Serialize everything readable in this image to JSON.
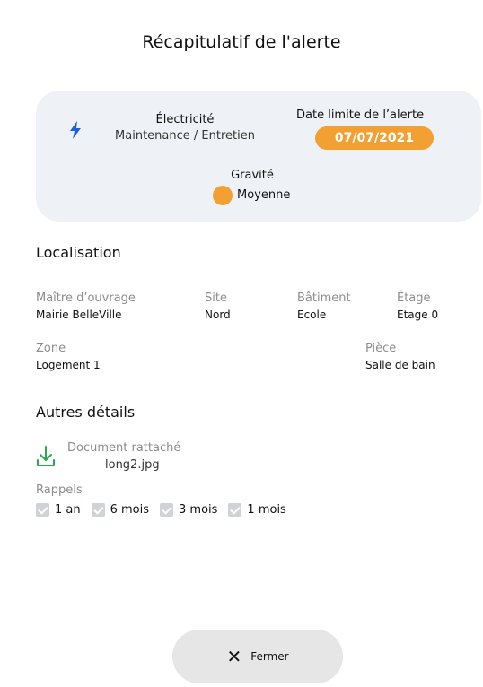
{
  "title": "Récapitulatif de l'alerte",
  "summary": {
    "category": "Électricité",
    "subcategory": "Maintenance / Entretien",
    "deadline_label": "Date limite de l’alerte",
    "deadline": "07/07/2021",
    "severity_label": "Gravité",
    "severity": "Moyenne",
    "severity_color": "#f3a033",
    "category_icon": "lightning-bolt-icon"
  },
  "location": {
    "section_title": "Localisation",
    "owner_label": "Maître d’ouvrage",
    "owner": "Mairie BelleVille",
    "site_label": "Site",
    "site": "Nord",
    "building_label": "Bâtiment",
    "building": "Ecole",
    "floor_label": "Étage",
    "floor": "Etage 0",
    "zone_label": "Zone",
    "zone": "Logement 1",
    "room_label": "Pièce",
    "room": "Salle de bain"
  },
  "details": {
    "section_title": "Autres détails",
    "document_label": "Document rattaché",
    "document_file": "long2.jpg",
    "reminders_label": "Rappels",
    "reminders": [
      "1 an",
      "6 mois",
      "3 mois",
      "1 mois"
    ]
  },
  "close_button": {
    "label": "Fermer",
    "icon": "close-icon"
  },
  "colors": {
    "accent": "#f3a033",
    "icon_blue": "#1e5fe0",
    "icon_green": "#2aa84a",
    "card_bg": "#eef2f6"
  }
}
